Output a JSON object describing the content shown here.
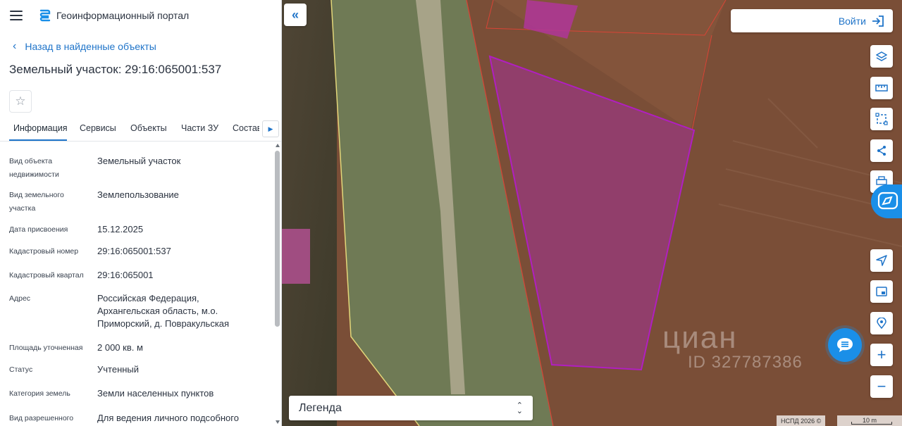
{
  "header": {
    "title": "Геоинформационный портал"
  },
  "nav": {
    "back_label": "Назад в найденные объекты"
  },
  "object": {
    "title": "Земельный участок: 29:16:065001:537"
  },
  "tabs": [
    {
      "label": "Информация"
    },
    {
      "label": "Сервисы"
    },
    {
      "label": "Объекты"
    },
    {
      "label": "Части ЗУ"
    },
    {
      "label": "Состав"
    }
  ],
  "properties": [
    {
      "label": "Вид объекта недвижимости",
      "value": "Земельный участок"
    },
    {
      "label": "Вид земельного участка",
      "value": "Землепользование"
    },
    {
      "label": "Дата присвоения",
      "value": "15.12.2025"
    },
    {
      "label": "Кадастровый номер",
      "value": "29:16:065001:537"
    },
    {
      "label": "Кадастровый квартал",
      "value": "29:16:065001"
    },
    {
      "label": "Адрес",
      "value": "Российская Федерация, Архангельская область, м.о. Приморский, д. Повракульская"
    },
    {
      "label": "Площадь уточненная",
      "value": "2 000 кв. м"
    },
    {
      "label": "Статус",
      "value": "Учтенный"
    },
    {
      "label": "Категория земель",
      "value": "Земли населенных пунктов"
    },
    {
      "label": "Вид разрешенного",
      "value": "Для ведения личного подсобного"
    }
  ],
  "map": {
    "login_label": "Войти",
    "legend_label": "Легенда",
    "watermark_brand": "циан",
    "watermark_id": "ID 327787386",
    "attribution": "НСПД 2026 ©",
    "scale_label": "10 m"
  },
  "colors": {
    "accent": "#1f74c9",
    "chat": "#1a8fe8",
    "parcel_stroke": "#b01fc0"
  }
}
